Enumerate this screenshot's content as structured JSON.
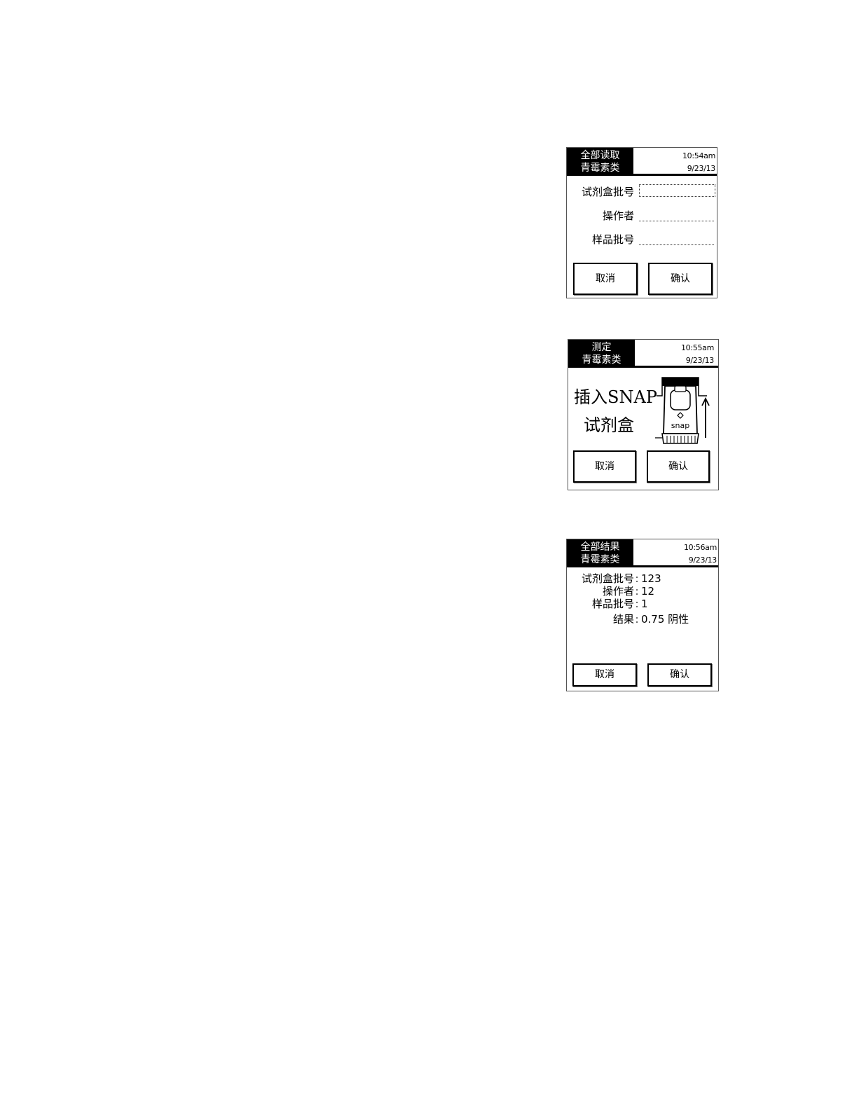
{
  "screens": [
    {
      "title_line1": "全部读取",
      "title_line2": "青霉素类",
      "time": "10:54am",
      "date": "9/23/13",
      "fields": [
        {
          "label": "试剂盒批号",
          "colon": ":",
          "value": ""
        },
        {
          "label": "操作者",
          "colon": ":",
          "value": ""
        },
        {
          "label": "样品批号",
          "colon": ":",
          "value": ""
        }
      ],
      "cancel_label": "取消",
      "confirm_label": "确认"
    },
    {
      "title_line1": "测定",
      "title_line2": "青霉素类",
      "time": "10:55am",
      "date": "9/23/13",
      "prompt_line1": "插入SNAP",
      "prompt_line2": "试剂盒",
      "device_label": "snap",
      "cancel_label": "取消",
      "confirm_label": "确认"
    },
    {
      "title_line1": "全部结果",
      "title_line2": "青霉素类",
      "time": "10:56am",
      "date": "9/23/13",
      "results": [
        {
          "label": "试剂盒批号",
          "colon": ":",
          "value": "123"
        },
        {
          "label": "操作者",
          "colon": ":",
          "value": "12"
        },
        {
          "label": "样品批号",
          "colon": ":",
          "value": "1"
        },
        {
          "label": "结果",
          "colon": ":",
          "value": "0.75 阴性"
        }
      ],
      "cancel_label": "取消",
      "confirm_label": "确认"
    }
  ]
}
